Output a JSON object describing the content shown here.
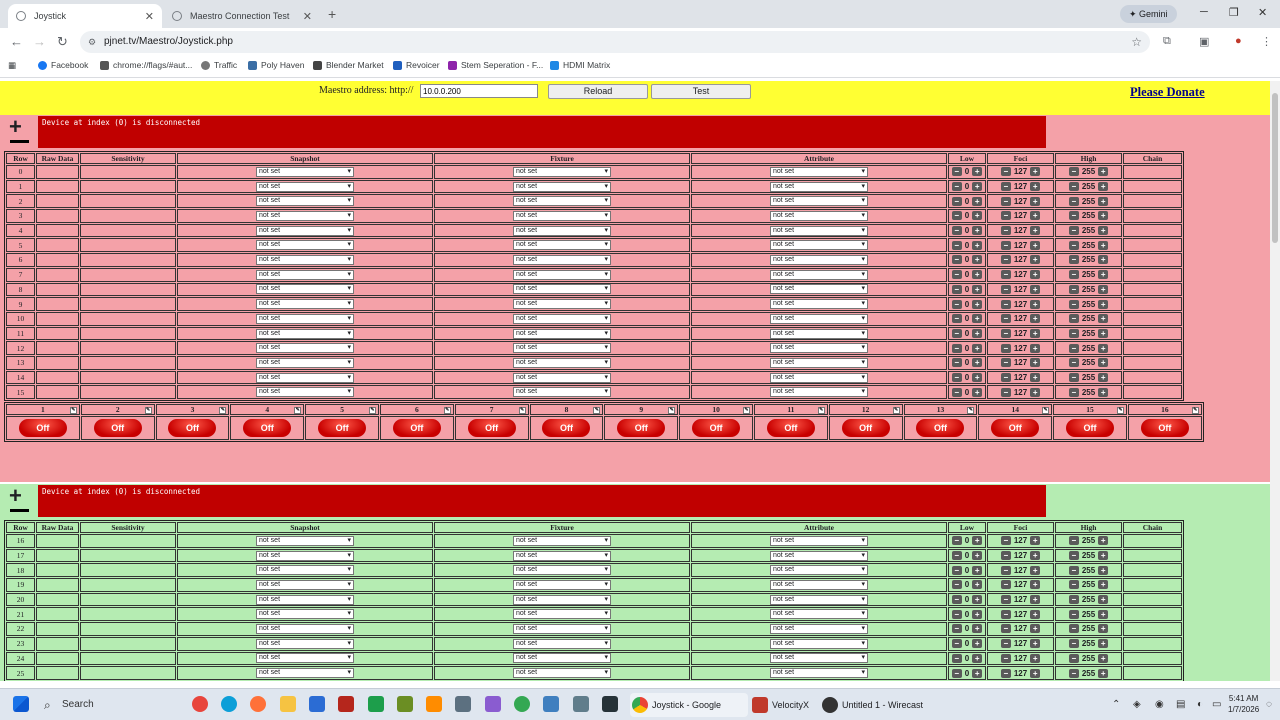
{
  "browser": {
    "tabs": [
      {
        "title": "Joystick",
        "active": true
      },
      {
        "title": "Maestro Connection Test",
        "active": false
      }
    ],
    "gemini_label": "Gemini",
    "url": "pjnet.tv/Maestro/Joystick.php",
    "bookmarks": [
      "Facebook",
      "chrome://flags/#aut...",
      "Traffic",
      "Poly Haven",
      "Blender Market",
      "Revoicer",
      "Stem Seperation - F...",
      "HDMI Matrix"
    ]
  },
  "page": {
    "maestro_label": "Maestro address: http://",
    "maestro_address": "10.0.0.200",
    "reload_label": "Reload",
    "test_label": "Test",
    "donate_label": "Please Donate",
    "columns": [
      "Row",
      "Raw Data",
      "Sensitivity",
      "Snapshot",
      "Fixture",
      "Attribute",
      "Low",
      "Foci",
      "High",
      "Chain"
    ],
    "select_value": "not set",
    "low_value": "0",
    "foci_value": "127",
    "high_value": "255",
    "off_label": "Off",
    "devices": [
      {
        "status": "Device at index (0) is disconnected",
        "color": "#f4a1a8",
        "rows": [
          "0",
          "1",
          "2",
          "3",
          "4",
          "5",
          "6",
          "7",
          "8",
          "9",
          "10",
          "11",
          "12",
          "13",
          "14",
          "15"
        ],
        "channels": [
          "1",
          "2",
          "3",
          "4",
          "5",
          "6",
          "7",
          "8",
          "9",
          "10",
          "11",
          "12",
          "13",
          "14",
          "15",
          "16"
        ]
      },
      {
        "status": "Device at index (0) is disconnected",
        "color": "#b5ecb2",
        "rows": [
          "16",
          "17",
          "18",
          "19",
          "20",
          "21",
          "22",
          "23",
          "24",
          "25"
        ]
      }
    ]
  },
  "taskbar": {
    "search_placeholder": "Search",
    "apps": [
      "Joystick - Google Chron",
      "VelocityX",
      "Untitled 1 - Wirecast"
    ],
    "time": "5:41 AM",
    "date": "1/7/2026"
  }
}
